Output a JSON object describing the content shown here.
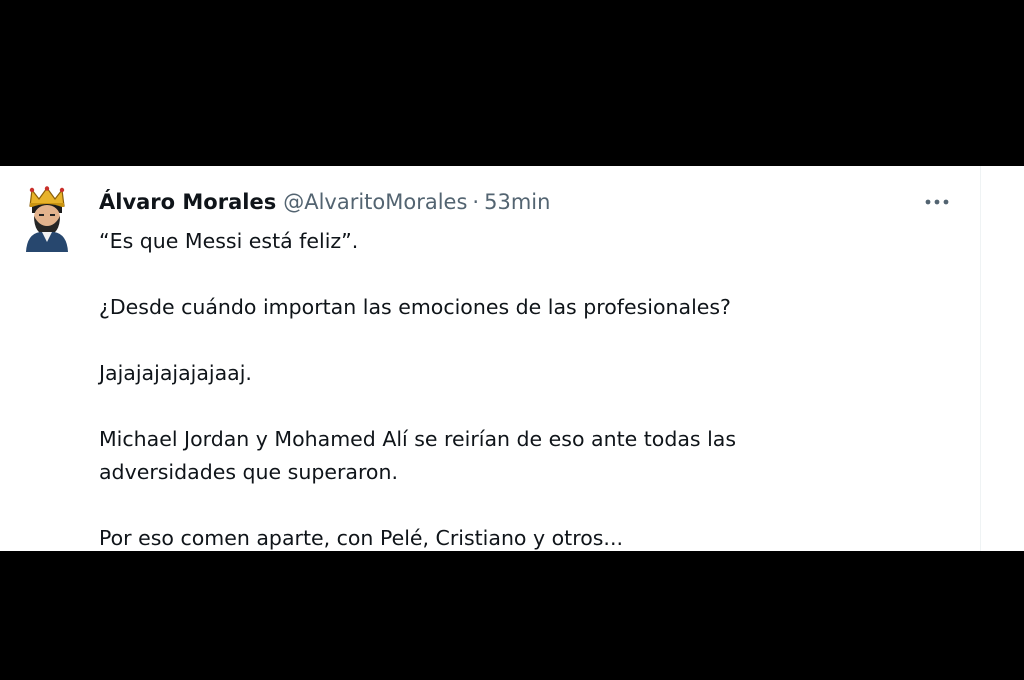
{
  "colors": {
    "background_letterbox": "#000000",
    "card_background": "#ffffff",
    "text_primary": "#0f1419",
    "text_secondary": "#536471"
  },
  "tweet": {
    "author": {
      "display_name": "Álvaro Morales",
      "handle": "@AlvaritoMorales",
      "avatar_icon": "crowned-man-avatar-icon"
    },
    "separator": "·",
    "timestamp": "53min",
    "more_icon": "more-horizontal-icon",
    "paragraphs": [
      "“Es que Messi está feliz”.",
      "¿Desde cuándo importan las emociones de las profesionales?",
      "Jajajajajajajaaj.",
      "Michael Jordan y Mohamed Alí se reirían de eso ante todas las adversidades que superaron.",
      "Por eso comen aparte, con Pelé, Cristiano y otros..."
    ]
  }
}
